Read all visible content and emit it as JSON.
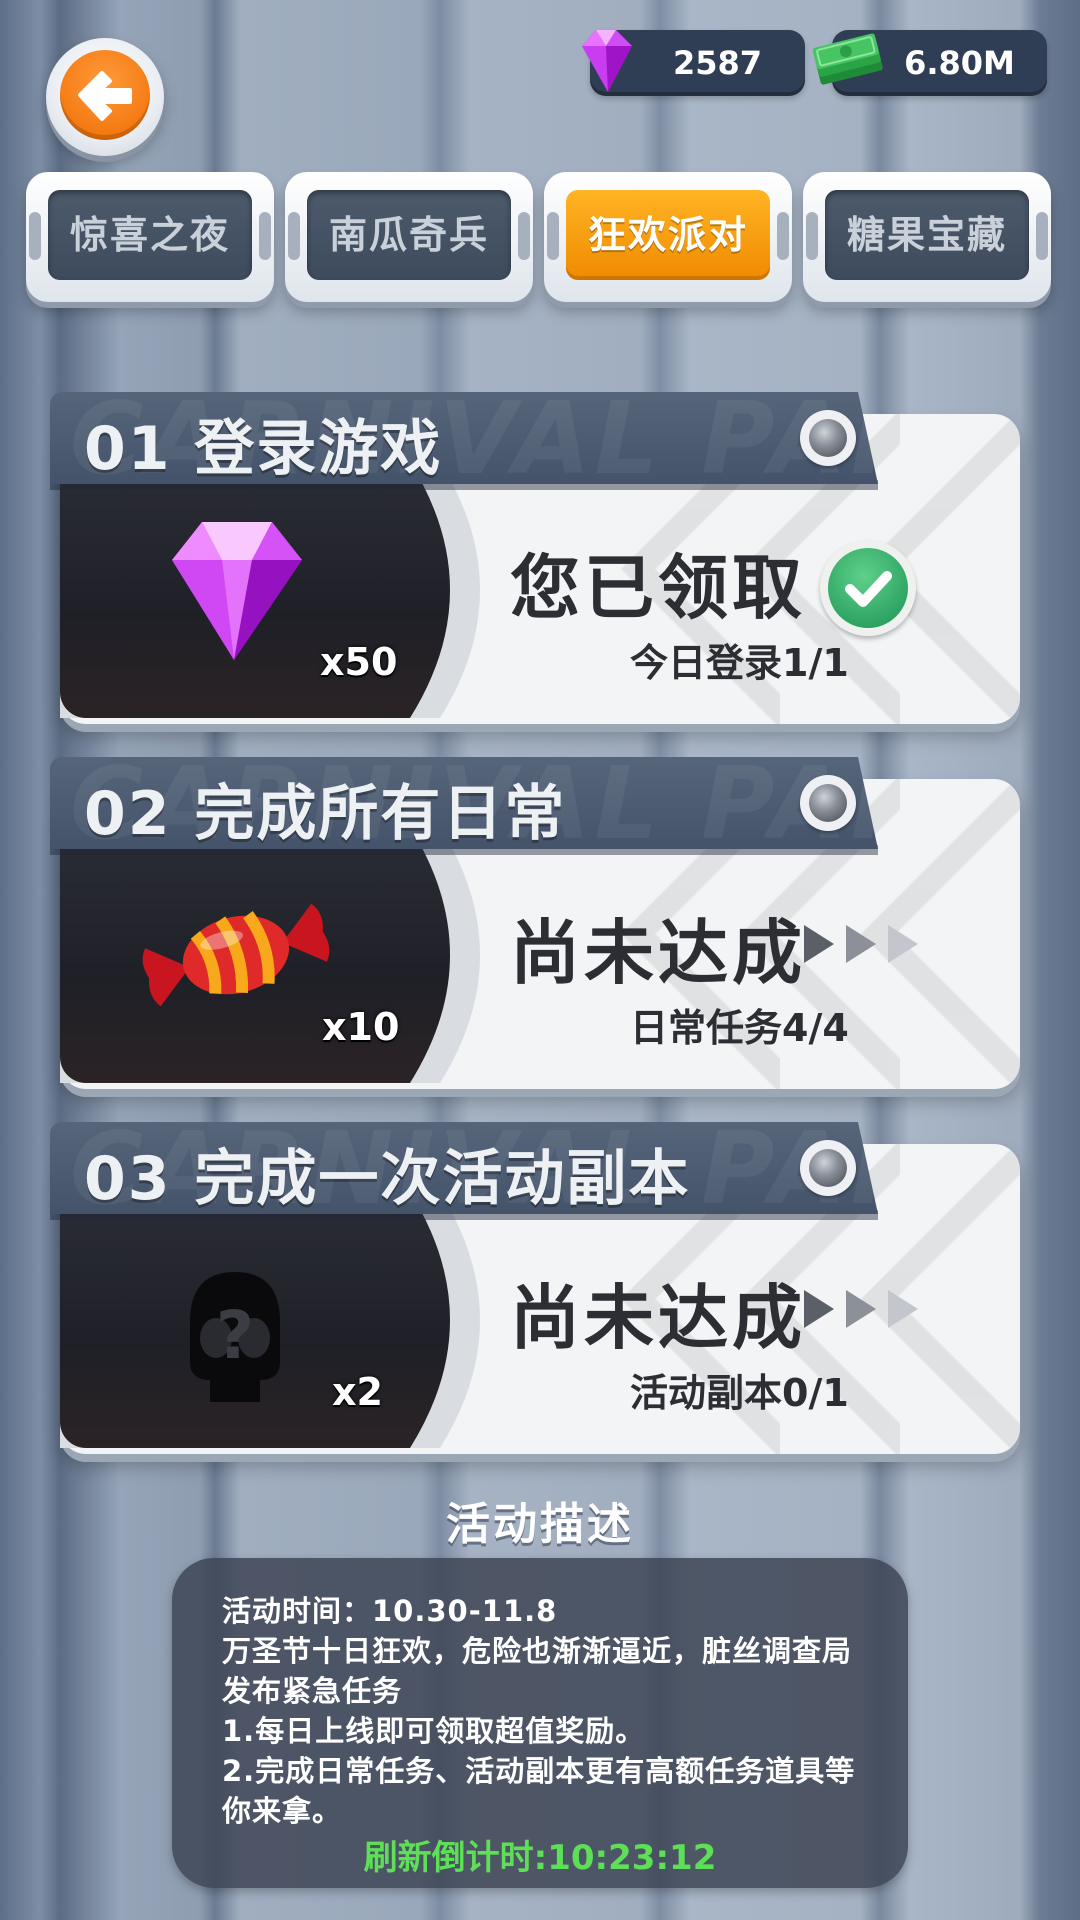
{
  "currency": {
    "gems": "2587",
    "cash": "6.80M",
    "colors": {
      "gem": "#c43cf0",
      "cash": "#3bbf4f"
    }
  },
  "tabs": [
    {
      "label": "惊喜之夜",
      "active": false
    },
    {
      "label": "南瓜奇兵",
      "active": false
    },
    {
      "label": "狂欢派对",
      "active": true
    },
    {
      "label": "糖果宝藏",
      "active": false
    }
  ],
  "quests": [
    {
      "title": "01 登录游戏",
      "watermark": "CARNIVAL PARTY",
      "reward_icon": "gem-icon",
      "qty": "x50",
      "status": "您已领取",
      "progress": "今日登录1/1",
      "claimed": true
    },
    {
      "title": "02 完成所有日常",
      "watermark": "CARNIVAL PARTY",
      "reward_icon": "candy-icon",
      "qty": "x10",
      "status": "尚未达成",
      "progress": "日常任务4/4",
      "claimed": false
    },
    {
      "title": "03 完成一次活动副本",
      "watermark": "CARNIVAL PARTY",
      "reward_icon": "mystery-character-icon",
      "qty": "x2",
      "status": "尚未达成",
      "progress": "活动副本0/1",
      "claimed": false
    }
  ],
  "description": {
    "title": "活动描述",
    "lines": [
      "活动时间：10.30-11.8",
      "万圣节十日狂欢，危险也渐渐逼近，脏丝调查局",
      "发布紧急任务",
      "1.每日上线即可领取超值奖励。",
      "2.完成日常任务、活动副本更有高额任务道具等",
      "你来拿。"
    ],
    "countdown": "刷新倒计时:10:23:12"
  },
  "colors": {
    "accent_tab": "#f5960f",
    "countdown": "#5de057",
    "claimed_check": "#2fa564"
  }
}
